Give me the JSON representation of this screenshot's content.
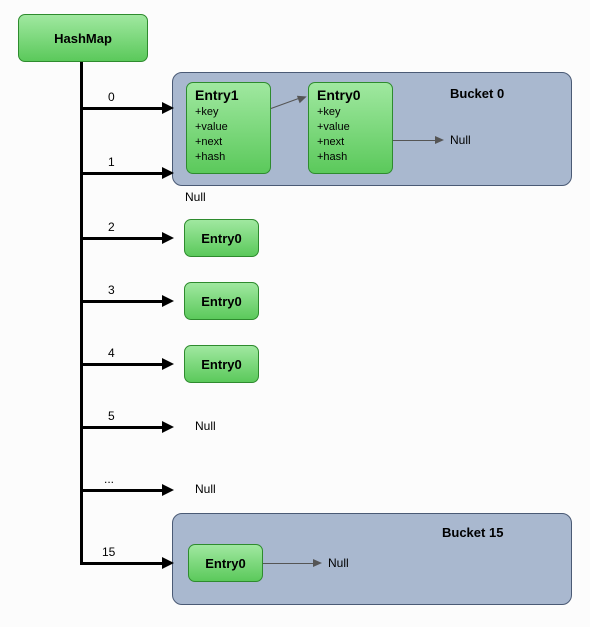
{
  "root": {
    "label": "HashMap"
  },
  "indices": {
    "i0": "0",
    "i1": "1",
    "i2": "2",
    "i3": "3",
    "i4": "4",
    "i5": "5",
    "idots": "...",
    "i15": "15"
  },
  "nulls": {
    "n1": "Null",
    "n5": "Null",
    "ndots": "Null",
    "b0_null": "Null",
    "b15_null": "Null"
  },
  "entries": {
    "e2": "Entry0",
    "e3": "Entry0",
    "e4": "Entry0",
    "e15": "Entry0"
  },
  "bucket0": {
    "label": "Bucket 0",
    "entry_a": {
      "title": "Entry1",
      "f1": "+key",
      "f2": "+value",
      "f3": "+next",
      "f4": "+hash"
    },
    "entry_b": {
      "title": "Entry0",
      "f1": "+key",
      "f2": "+value",
      "f3": "+next",
      "f4": "+hash"
    }
  },
  "bucket15": {
    "label": "Bucket 15",
    "entry": "Entry0"
  }
}
